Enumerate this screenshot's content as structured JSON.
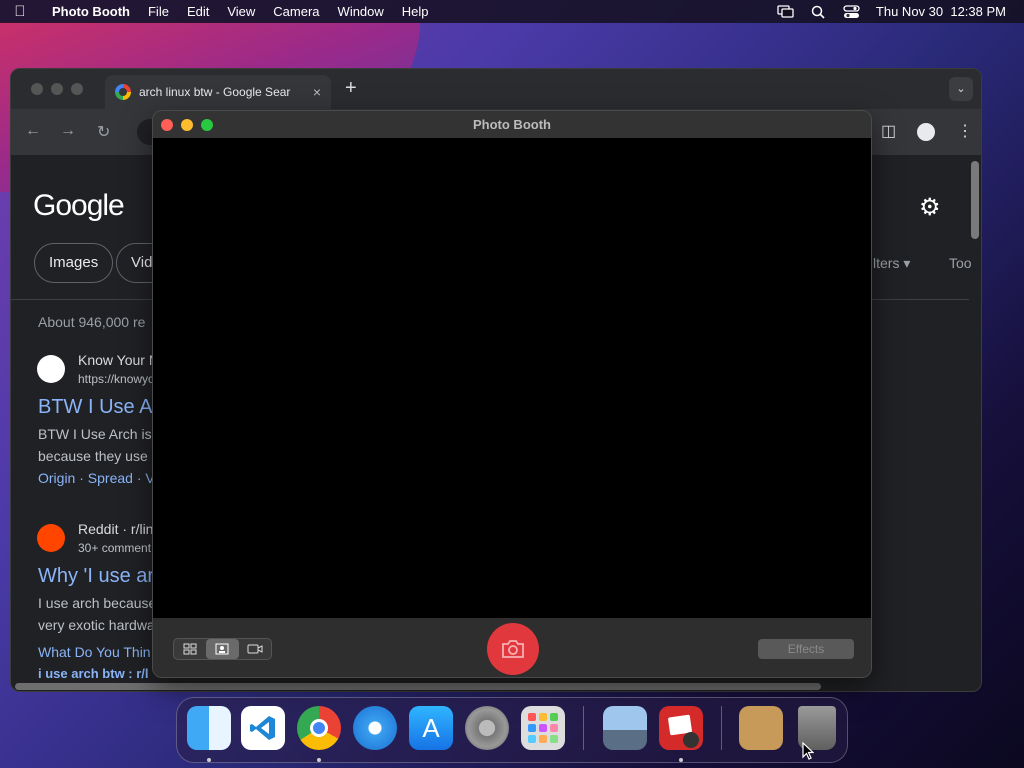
{
  "menubar": {
    "app_name": "Photo Booth",
    "items": [
      "File",
      "Edit",
      "View",
      "Camera",
      "Window",
      "Help"
    ],
    "clock": "Thu Nov 30  12:38 PM"
  },
  "chrome": {
    "tab_title": "arch linux btw - Google Sear",
    "new_tab": "+",
    "tab_close": "×",
    "logo": "Google",
    "pills": [
      "Images",
      "Vide"
    ],
    "filters": "lters ▾",
    "tools": "Too",
    "stats": "About 946,000 re",
    "results": [
      {
        "site": "Know Your M",
        "url": "https://knowyo",
        "title": "BTW I Use A",
        "snippet1": "BTW I Use Arch is",
        "snippet2": "because they use",
        "links": "Origin · Spread · V"
      },
      {
        "site": "Reddit · r/lin",
        "url": "30+ comment",
        "title": "Why 'I use ar",
        "snippet1": "I use arch because",
        "snippet2": "very exotic hardwa",
        "links": "What Do You Thin",
        "links2": "i use arch btw : r/l"
      }
    ]
  },
  "photobooth": {
    "title": "Photo Booth",
    "effects_label": "Effects"
  },
  "colors": {
    "accent_link": "#8ab4f8",
    "shutter": "#e0383d"
  }
}
